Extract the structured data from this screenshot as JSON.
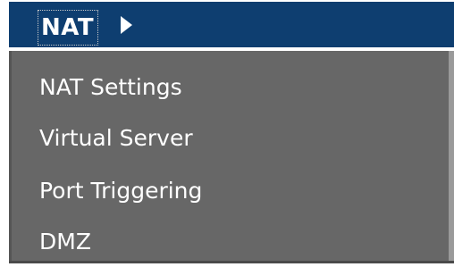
{
  "menu": {
    "title": "NAT",
    "items": [
      {
        "label": "NAT Settings"
      },
      {
        "label": "Virtual Server"
      },
      {
        "label": "Port Triggering"
      },
      {
        "label": "DMZ"
      }
    ]
  },
  "colors": {
    "header_background": "#0e3e70",
    "body_background": "#676767",
    "text": "#ffffff"
  },
  "icons": {
    "header_expand": "triangle-right-icon"
  }
}
